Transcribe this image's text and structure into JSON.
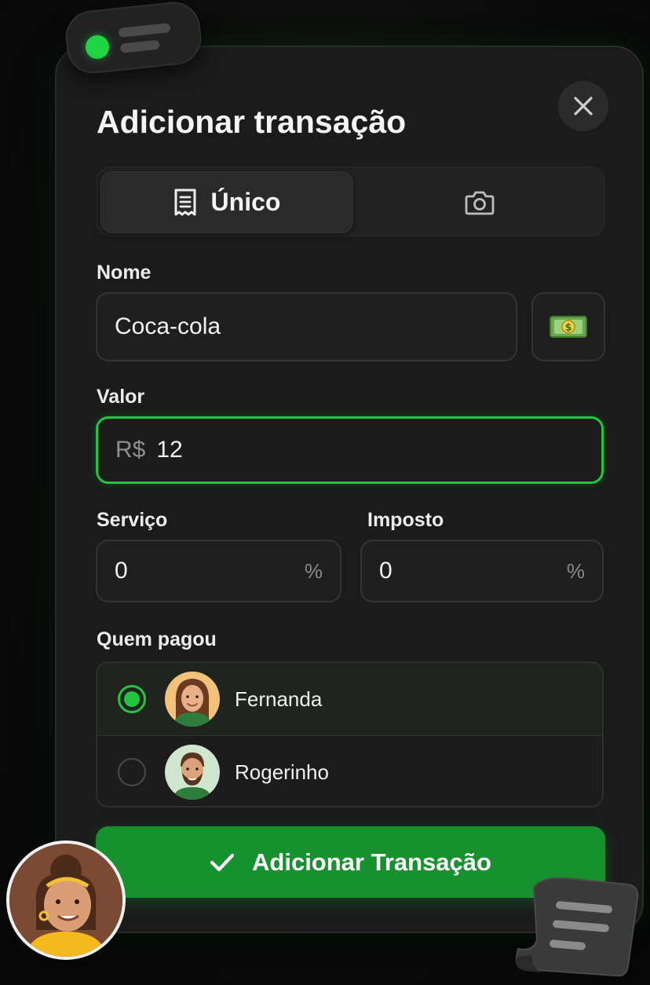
{
  "dialog": {
    "title": "Adicionar transação",
    "close_icon": "close-icon"
  },
  "mode_tabs": [
    {
      "label": "Único",
      "icon": "receipt-icon",
      "selected": true
    },
    {
      "label": "",
      "icon": "camera-icon",
      "selected": false
    }
  ],
  "form": {
    "name_label": "Nome",
    "name_value": "Coca-cola",
    "money_icon": "money-icon",
    "value_label": "Valor",
    "currency_prefix": "R$",
    "value_amount": "12",
    "service_label": "Serviço",
    "service_value": "0",
    "service_suffix": "%",
    "tax_label": "Imposto",
    "tax_value": "0",
    "tax_suffix": "%"
  },
  "payers": {
    "label": "Quem pagou",
    "items": [
      {
        "name": "Fernanda",
        "selected": true
      },
      {
        "name": "Rogerinho",
        "selected": false
      }
    ]
  },
  "submit": {
    "label": "Adicionar Transação",
    "icon": "check-icon"
  },
  "colors": {
    "accent": "#22c540",
    "button": "#17902e",
    "background": "#1b1b1b"
  }
}
